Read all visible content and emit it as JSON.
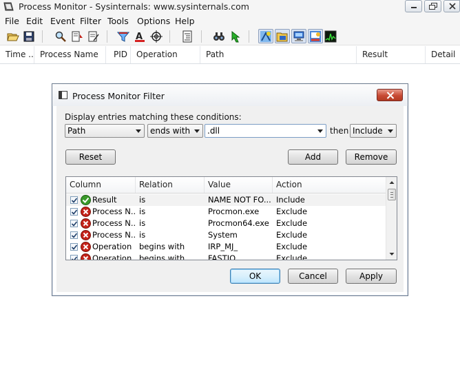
{
  "window": {
    "title": "Process Monitor - Sysinternals: www.sysinternals.com"
  },
  "menu": [
    "File",
    "Edit",
    "Event",
    "Filter",
    "Tools",
    "Options",
    "Help"
  ],
  "toolbar": {
    "icons": [
      "open-icon",
      "save-icon",
      "magnifier-icon",
      "autoscroll-icon",
      "clear-icon",
      "filter-icon",
      "highlight-icon",
      "target-icon",
      "process-tree-icon",
      "find-icon",
      "jump-icon",
      "registry-activity-icon",
      "file-activity-icon",
      "network-activity-icon",
      "process-activity-icon",
      "profiling-icon"
    ]
  },
  "columns": [
    "Time ...",
    "Process Name",
    "PID",
    "Operation",
    "Path",
    "Result",
    "Detail"
  ],
  "dialog": {
    "title": "Process Monitor Filter",
    "prompt": "Display entries matching these conditions:",
    "column_select": "Path",
    "relation_select": "ends with",
    "value_input": ".dll",
    "then_label": "then",
    "action_select": "Include",
    "reset_label": "Reset",
    "add_label": "Add",
    "remove_label": "Remove",
    "ok_label": "OK",
    "cancel_label": "Cancel",
    "apply_label": "Apply",
    "list_headers": [
      "Column",
      "Relation",
      "Value",
      "Action"
    ],
    "rows": [
      {
        "checked": true,
        "icon": "include-check-icon",
        "column": "Result",
        "relation": "is",
        "value": "NAME NOT FO...",
        "action": "Include"
      },
      {
        "checked": true,
        "icon": "exclude-x-icon",
        "column": "Process N...",
        "relation": "is",
        "value": "Procmon.exe",
        "action": "Exclude"
      },
      {
        "checked": true,
        "icon": "exclude-x-icon",
        "column": "Process N...",
        "relation": "is",
        "value": "Procmon64.exe",
        "action": "Exclude"
      },
      {
        "checked": true,
        "icon": "exclude-x-icon",
        "column": "Process N...",
        "relation": "is",
        "value": "System",
        "action": "Exclude"
      },
      {
        "checked": true,
        "icon": "exclude-x-icon",
        "column": "Operation",
        "relation": "begins with",
        "value": "IRP_MJ_",
        "action": "Exclude"
      },
      {
        "checked": true,
        "icon": "exclude-x-icon",
        "column": "Operation",
        "relation": "begins with",
        "value": "FASTIO_",
        "action": "Exclude"
      }
    ]
  },
  "colors": {
    "include": "#3a9a2a",
    "exclude": "#c4231a",
    "dialog_close": "#c84a34"
  }
}
